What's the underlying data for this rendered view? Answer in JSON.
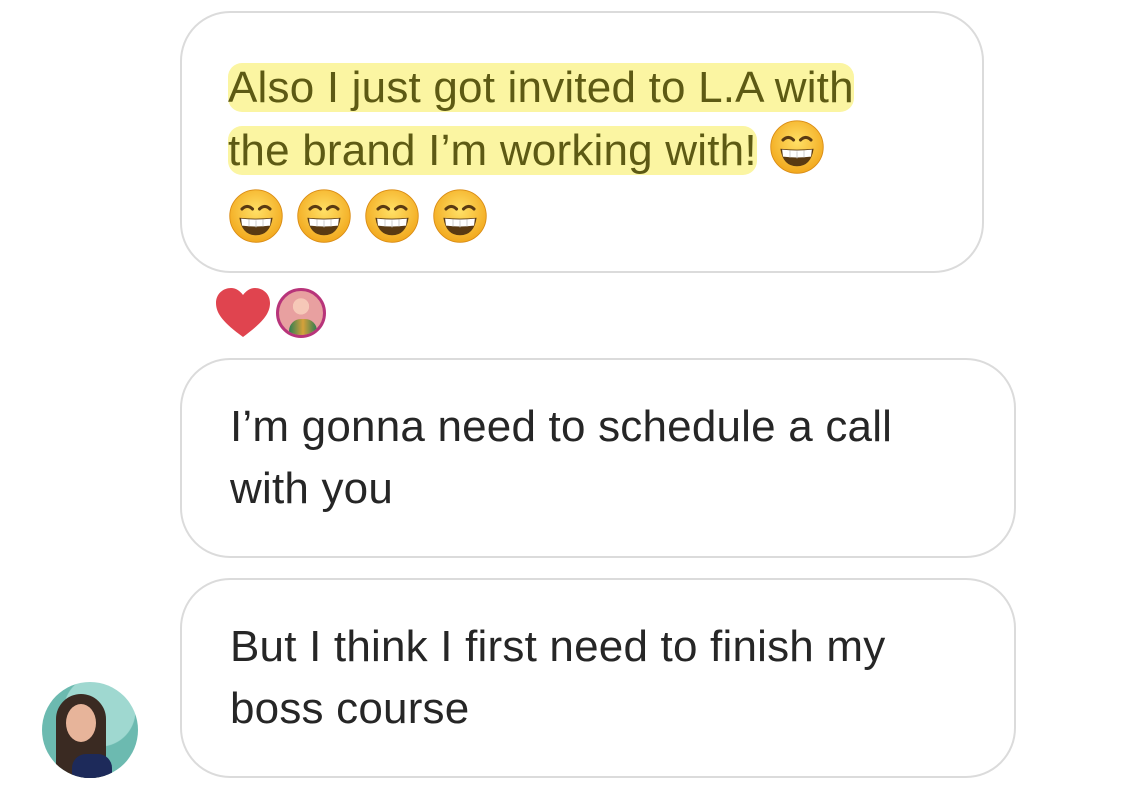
{
  "messages": [
    {
      "lines": [
        "Also I just got invited to L.A with",
        "the brand I’m working with!"
      ],
      "highlighted": true,
      "inline_emoji": "grinning-face-with-smiling-eyes",
      "emoji_row_count": 4,
      "reactions": [
        "red-heart",
        "reactor-avatar"
      ]
    },
    {
      "lines": [
        "I’m gonna need to schedule a call",
        "with you"
      ]
    },
    {
      "lines": [
        "But I think I first need to finish my",
        "boss course"
      ]
    }
  ],
  "sender": {
    "avatar": "profile-photo"
  },
  "colors": {
    "bubble_border": "#dbdbdb",
    "highlight": "#fbf5a2",
    "highlight_text": "#5d5a14",
    "text": "#262626",
    "heart": "#e0444f"
  }
}
